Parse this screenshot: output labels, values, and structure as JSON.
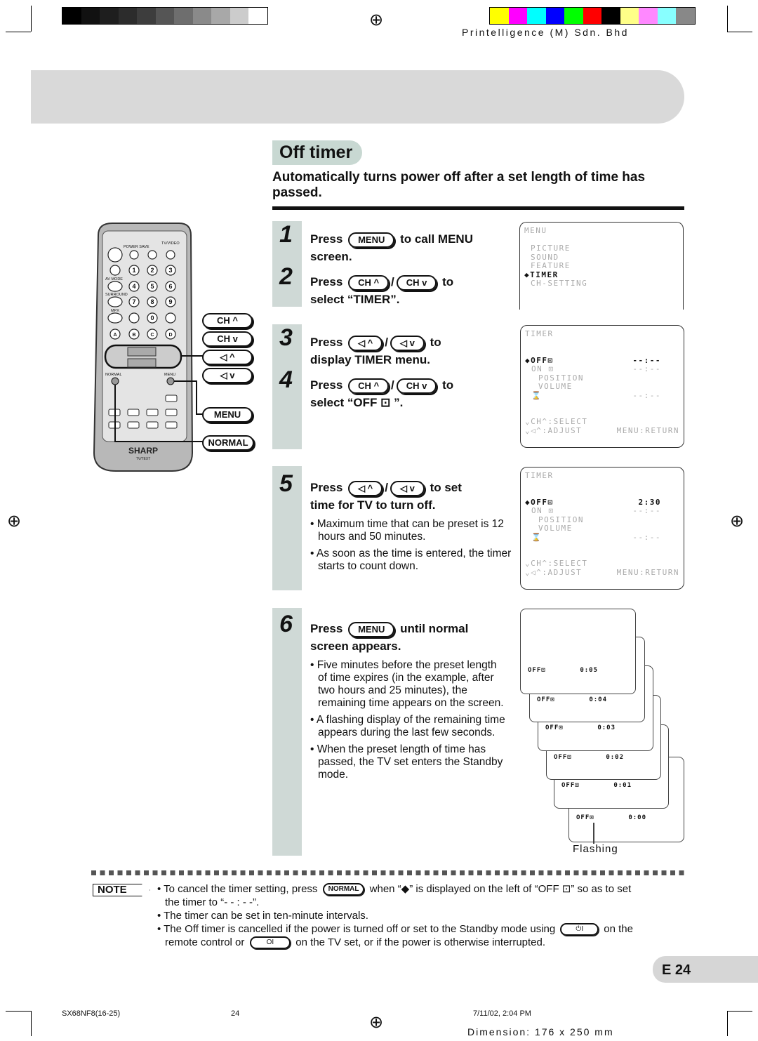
{
  "header": {
    "printer": "Printelligence (M) Sdn. Bhd",
    "gray_swatches": [
      "#000000",
      "#111111",
      "#1e1e1e",
      "#2c2c2c",
      "#3d3d3d",
      "#555555",
      "#6e6e6e",
      "#8a8a8a",
      "#a8a8a8",
      "#cccccc",
      "#ffffff"
    ],
    "color_swatches": [
      "#ffff00",
      "#ff00ff",
      "#00ffff",
      "#0000ff",
      "#00ff00",
      "#ff0000",
      "#000000",
      "#ffff88",
      "#ff88ff",
      "#88ffff",
      "#888888"
    ]
  },
  "section": {
    "title": "Off timer",
    "subtitle": "Automatically turns power off after a set length of time has passed.",
    "accent": "#c8d8d2"
  },
  "remote": {
    "brand": "SHARP",
    "model": "TV/TEXT",
    "labels": [
      "POWER SAVE",
      "TV/VIDEO",
      "AV MODE",
      "SURROUND",
      "MPX",
      "NORMAL",
      "MENU"
    ],
    "keys": [
      "1",
      "2",
      "3",
      "4",
      "5",
      "6",
      "7",
      "8",
      "9",
      "0",
      "A",
      "B",
      "C",
      "D"
    ],
    "callouts": [
      "CH ^",
      "CH v",
      "◁ ^",
      "◁ v",
      "MENU",
      "NORMAL"
    ]
  },
  "steps": [
    {
      "num": "1",
      "press": "Press",
      "btn": "MENU",
      "rest": "to call MENU",
      "line2": "screen."
    },
    {
      "num": "2",
      "press": "Press",
      "btn1": "CH ^",
      "sep": "/",
      "btn2": "CH v",
      "rest": "to",
      "line2": "select “TIMER”."
    },
    {
      "num": "3",
      "press": "Press",
      "btn1": "◁ ^",
      "sep": "/",
      "btn2": "◁ v",
      "rest": "to",
      "line2": "display TIMER menu."
    },
    {
      "num": "4",
      "press": "Press",
      "btn1": "CH ^",
      "sep": "/",
      "btn2": "CH v",
      "rest": "to",
      "line2": "select “OFF ⊡ ”."
    },
    {
      "num": "5",
      "press": "Press",
      "btn1": "◁ ^",
      "sep": "/",
      "btn2": "◁ v",
      "rest": "to set",
      "line2": "time for  TV to turn off.",
      "bullets": [
        "• Maximum time that can be preset is 12 hours and 50 minutes.",
        "• As soon as the time is entered, the timer starts to count down."
      ]
    },
    {
      "num": "6",
      "press": "Press",
      "btn": "MENU",
      "rest": "until normal",
      "line2": "screen appears.",
      "bullets": [
        "• Five minutes before the preset length of time expires (in the example, after two hours and 25 minutes), the remaining time appears on the screen.",
        "• A flashing display of the remaining time appears during the last few seconds.",
        "• When the preset length of time has passed, the TV set enters the Standby mode."
      ]
    }
  ],
  "screens": {
    "menu": {
      "title": "MENU",
      "items": [
        "PICTURE",
        "SOUND",
        "FEATURE",
        "◆TIMER",
        "CH-SETTING"
      ]
    },
    "timer1": {
      "title": "TIMER",
      "off": "◆OFF⊡",
      "off_val": "--:--",
      "on": "ON ⊡",
      "on_val": "--:--",
      "position": "POSITION",
      "volume": "VOLUME",
      "sleep": "⌛",
      "sleep_val": "--:--",
      "hint1": "⌄CH^:SELECT",
      "hint2": "⌄◁^:ADJUST",
      "hint3": "MENU:RETURN"
    },
    "timer2": {
      "title": "TIMER",
      "off": "◆OFF⊡",
      "off_val": "2:30",
      "on": "ON ⊡",
      "on_val": "--:--",
      "position": "POSITION",
      "volume": "VOLUME",
      "sleep": "⌛",
      "sleep_val": "--:--",
      "hint1": "⌄CH^:SELECT",
      "hint2": "⌄◁^:ADJUST",
      "hint3": "MENU:RETURN"
    },
    "countdown": {
      "label": "OFF⊡",
      "times": [
        "0:05",
        "0:04",
        "0:03",
        "0:02",
        "0:01",
        "0:00"
      ],
      "flashing": "Flashing"
    }
  },
  "note": {
    "label": "NOTE",
    "l1a": "• To cancel the timer setting, press",
    "btn_normal": "NORMAL",
    "l1b": "when “◆” is displayed on the left of “OFF ⊡” so as to set",
    "l1c": "the timer to “- - : - -”.",
    "l2": "• The timer can be set in ten-minute intervals.",
    "l3a": "• The Off timer is cancelled if the power is turned off or set to the Standby mode using",
    "btn_power": "⏻I",
    "l3b": "on the",
    "l3c": "remote control or",
    "btn_tv": "OI",
    "l3d": "on the TV set, or if the power is otherwise interrupted."
  },
  "page": {
    "number": "E 24"
  },
  "footer": {
    "file": "SX68NF8(16-25)",
    "page": "24",
    "date": "7/11/02, 2:04 PM",
    "dimension": "Dimension: 176 x 250 mm"
  }
}
